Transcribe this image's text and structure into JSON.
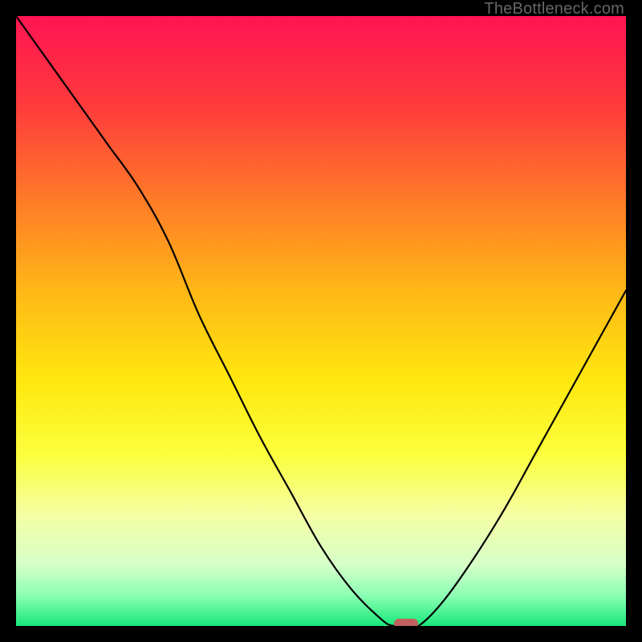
{
  "watermark": "TheBottleneck.com",
  "marker": {
    "color": "#C1605F"
  },
  "chart_data": {
    "type": "line",
    "title": "",
    "xlabel": "",
    "ylabel": "",
    "xlim": [
      0,
      100
    ],
    "ylim": [
      0,
      100
    ],
    "grid": false,
    "legend": false,
    "background": "rainbow-vertical-gradient",
    "series": [
      {
        "name": "bottleneck-curve",
        "x": [
          0,
          5,
          10,
          15,
          20,
          25,
          30,
          35,
          40,
          45,
          50,
          55,
          60,
          62,
          64,
          66,
          70,
          75,
          80,
          85,
          90,
          95,
          100
        ],
        "values": [
          100,
          93,
          86,
          79,
          72,
          63,
          51,
          41,
          31,
          22,
          13,
          6,
          1,
          0,
          0,
          0,
          4,
          11,
          19,
          28,
          37,
          46,
          55
        ]
      }
    ],
    "annotations": [
      {
        "type": "marker",
        "shape": "pill",
        "x": 64,
        "y": 0,
        "color": "#C1605F"
      }
    ],
    "gradient_stops": [
      {
        "offset": 0.0,
        "color": "#FF1452"
      },
      {
        "offset": 0.15,
        "color": "#FF3C3C"
      },
      {
        "offset": 0.3,
        "color": "#FF7A28"
      },
      {
        "offset": 0.45,
        "color": "#FFB716"
      },
      {
        "offset": 0.6,
        "color": "#FFE80F"
      },
      {
        "offset": 0.72,
        "color": "#FBFF3D"
      },
      {
        "offset": 0.82,
        "color": "#F4FFA6"
      },
      {
        "offset": 0.9,
        "color": "#D6FFC8"
      },
      {
        "offset": 0.95,
        "color": "#8CFFB4"
      },
      {
        "offset": 1.0,
        "color": "#18E87A"
      }
    ]
  }
}
